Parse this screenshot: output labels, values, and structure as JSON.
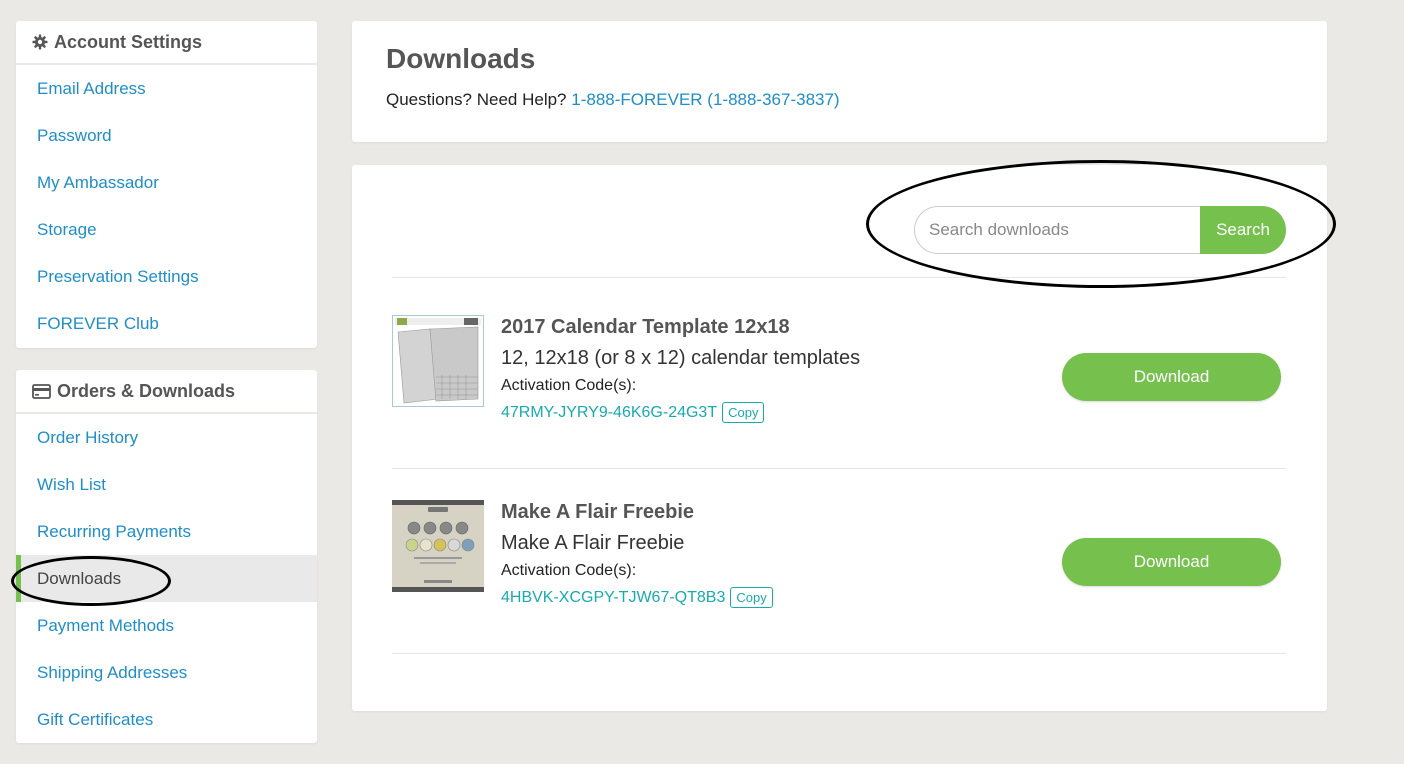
{
  "sidebar": {
    "account": {
      "heading": "Account Settings",
      "icon": "gear-icon",
      "items": [
        {
          "label": "Email Address"
        },
        {
          "label": "Password"
        },
        {
          "label": "My Ambassador"
        },
        {
          "label": "Storage"
        },
        {
          "label": "Preservation Settings"
        },
        {
          "label": "FOREVER Club"
        }
      ]
    },
    "orders": {
      "heading": "Orders & Downloads",
      "icon": "credit-card-icon",
      "items": [
        {
          "label": "Order History"
        },
        {
          "label": "Wish List"
        },
        {
          "label": "Recurring Payments"
        },
        {
          "label": "Downloads",
          "active": true
        },
        {
          "label": "Payment Methods"
        },
        {
          "label": "Shipping Addresses"
        },
        {
          "label": "Gift Certificates"
        }
      ]
    }
  },
  "header": {
    "title": "Downloads",
    "help_text": "Questions? Need Help?",
    "help_link": "1-888-FOREVER (1-888-367-3837)"
  },
  "search": {
    "placeholder": "Search downloads",
    "value": "",
    "button_label": "Search"
  },
  "downloads": [
    {
      "name": "2017 Calendar Template 12x18",
      "description": "12, 12x18 (or 8 x 12) calendar templates",
      "activation_label": "Activation Code(s):",
      "code": "47RMY-JYRY9-46K6G-24G3T",
      "copy_label": "Copy",
      "download_label": "Download"
    },
    {
      "name": "Make A Flair Freebie",
      "description": "Make A Flair Freebie",
      "activation_label": "Activation Code(s):",
      "code": "4HBVK-XCGPY-TJW67-QT8B3",
      "copy_label": "Copy",
      "download_label": "Download"
    }
  ],
  "colors": {
    "accent_green": "#76c04e",
    "link_blue": "#1f8ec7",
    "code_teal": "#19aab0",
    "page_bg": "#ebe9e5"
  }
}
